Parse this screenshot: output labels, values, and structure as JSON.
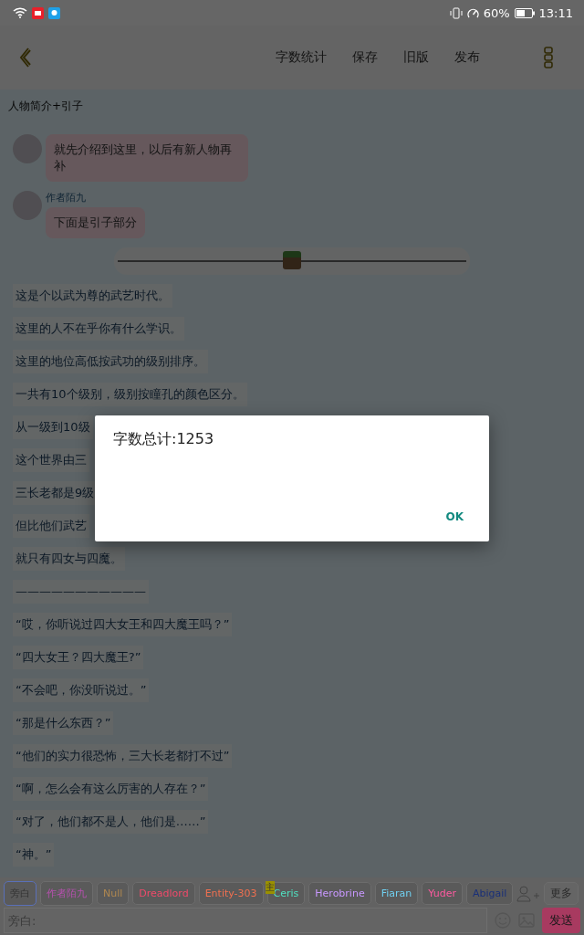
{
  "status_bar": {
    "battery": "60%",
    "time": "13:11"
  },
  "app_bar": {
    "actions": [
      "字数统计",
      "保存",
      "旧版",
      "发布"
    ]
  },
  "page_title": "人物简介+引子",
  "messages": [
    {
      "kind": "bubble",
      "text": "就先介绍到这里，以后有新人物再补"
    },
    {
      "kind": "bubble",
      "author": "作者陌九",
      "text": "下面是引子部分"
    },
    {
      "kind": "slider",
      "level": 0.5
    },
    {
      "kind": "line",
      "text": "这是个以武为尊的武艺时代。"
    },
    {
      "kind": "line",
      "text": "这里的人不在乎你有什么学识。"
    },
    {
      "kind": "line",
      "text": "这里的地位高低按武功的级别排序。"
    },
    {
      "kind": "line",
      "text": "一共有10个级别，级别按瞳孔的颜色区分。"
    },
    {
      "kind": "line",
      "text": "从一级到10级"
    },
    {
      "kind": "line",
      "text": "这个世界由三"
    },
    {
      "kind": "line",
      "text": "三长老都是9级"
    },
    {
      "kind": "line",
      "text": "但比他们武艺"
    },
    {
      "kind": "line",
      "text": "就只有四女与四魔。"
    },
    {
      "kind": "line",
      "text": "———————————"
    },
    {
      "kind": "line",
      "text": "“哎，你听说过四大女王和四大魔王吗？”"
    },
    {
      "kind": "line",
      "text": "“四大女王？四大魔王?”"
    },
    {
      "kind": "line",
      "text": "“不会吧，你没听说过。”"
    },
    {
      "kind": "line",
      "text": "“那是什么东西？”"
    },
    {
      "kind": "line",
      "text": "“他们的实力很恐怖，三大长老都打不过”"
    },
    {
      "kind": "line",
      "text": "“啊，怎么会有这么厉害的人存在？”"
    },
    {
      "kind": "line",
      "text": "“对了，他们都不是人，他们是……”"
    },
    {
      "kind": "line",
      "text": "“神。”"
    }
  ],
  "characters": [
    {
      "name": "旁白",
      "color": "#333333",
      "selected": true
    },
    {
      "name": "作者陌九",
      "color": "#b850b0",
      "selected": false
    },
    {
      "name": "Null",
      "color": "#b08850",
      "selected": false
    },
    {
      "name": "Dreadlord",
      "color": "#f04a6a",
      "selected": false
    },
    {
      "name": "Entity-303",
      "color": "#f07050",
      "selected": false
    },
    {
      "name": "Ceris",
      "color": "#50e0c0",
      "selected": false,
      "badge": "主"
    },
    {
      "name": "Herobrine",
      "color": "#c898ff",
      "selected": false
    },
    {
      "name": "Fiaran",
      "color": "#70d0f0",
      "selected": false
    },
    {
      "name": "Yuder",
      "color": "#ff5aa0",
      "selected": false
    },
    {
      "name": "Abigail",
      "color": "#1a3078",
      "selected": false
    }
  ],
  "more_button": "更多",
  "input": {
    "placeholder": "旁白:"
  },
  "send_button": "发送",
  "dialog": {
    "message": "字数总计:1253",
    "button": "OK"
  }
}
